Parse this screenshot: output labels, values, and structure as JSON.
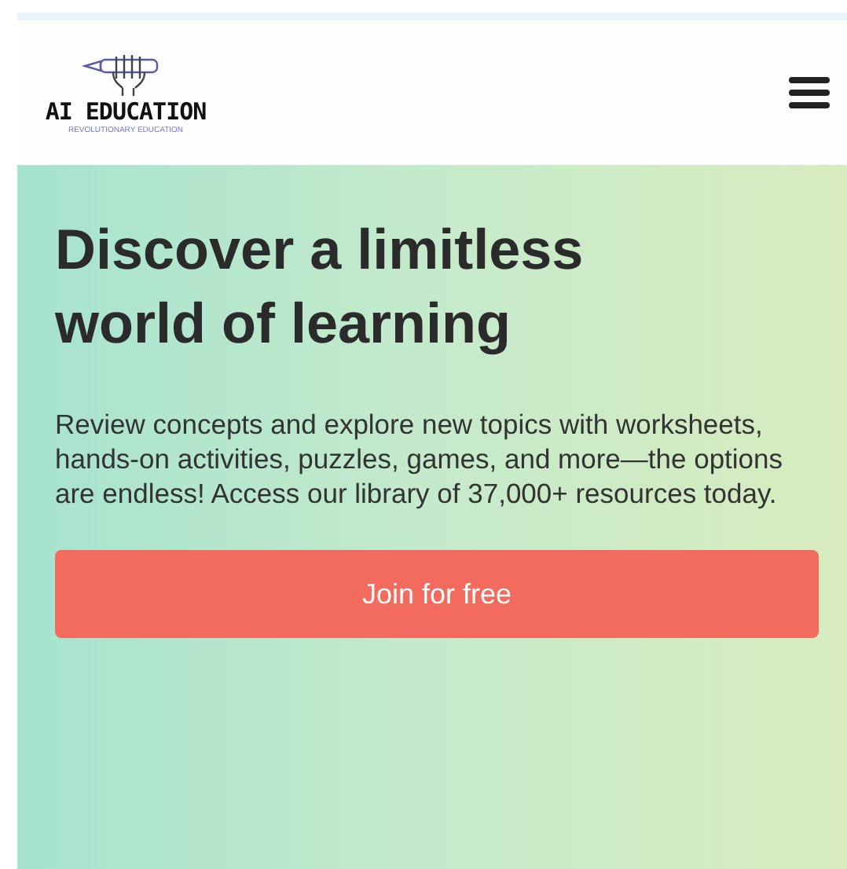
{
  "header": {
    "logo": {
      "name": "AI EDUCATION",
      "tagline": "REVOLUTIONARY EDUCATION"
    }
  },
  "hero": {
    "title": "Discover a limitless world of learning",
    "description": "Review concepts and explore new topics with worksheets, hands-on activities, puzzles, games, and more—the options are endless! Access our library of 37,000+ resources today.",
    "button": "Join for free"
  }
}
